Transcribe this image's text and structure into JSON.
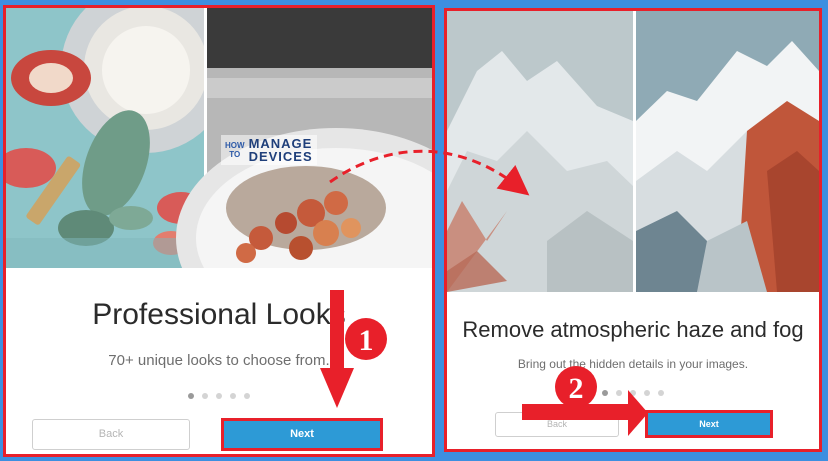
{
  "watermark": {
    "how": "HOW",
    "to": "TO",
    "manage": "MANAGE",
    "devices": "DEVICES"
  },
  "panels": [
    {
      "title": "Professional Looks",
      "subtitle": "70+ unique looks to choose from.",
      "back_label": "Back",
      "next_label": "Next",
      "dots_total": 5,
      "dots_active": 1
    },
    {
      "title": "Remove atmospheric haze and fog",
      "subtitle": "Bring out the hidden details in your images.",
      "back_label": "Back",
      "next_label": "Next",
      "dots_total": 5,
      "dots_active": 1
    }
  ],
  "annotations": {
    "step1": "1",
    "step2": "2"
  },
  "colors": {
    "accent_red": "#e8202a",
    "next_blue": "#2d9ad6",
    "background_blue": "#3d8fe0"
  }
}
